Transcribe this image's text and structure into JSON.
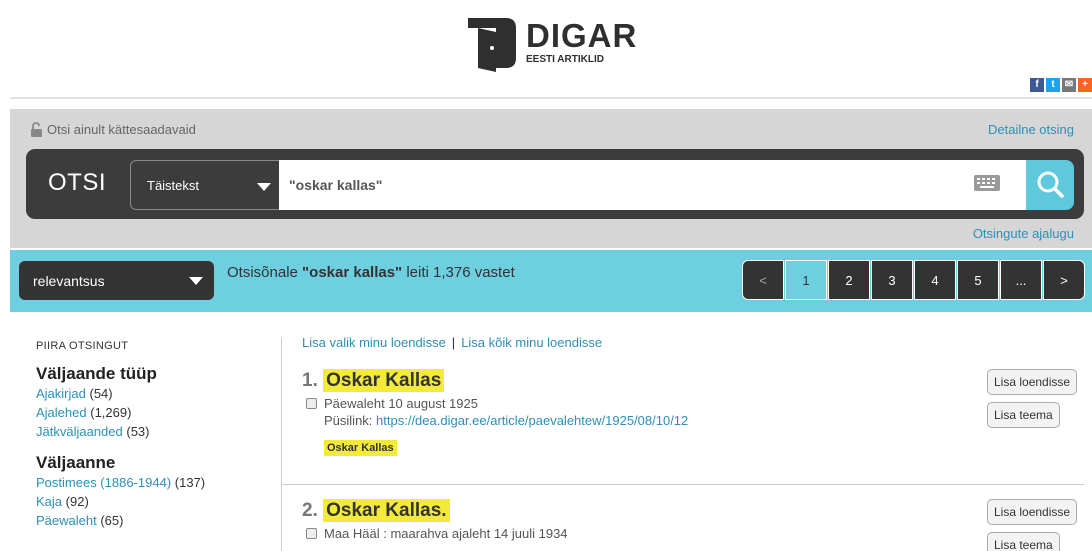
{
  "header": {
    "logo_title": "DIGAR",
    "logo_subtitle": "EESTI ARTIKLID",
    "social": [
      "f",
      "t",
      "✉",
      "+"
    ]
  },
  "search": {
    "only_available": "Otsi ainult kättesaadavaid",
    "detailed_link": "Detailne otsing",
    "otsi_label": "OTSI",
    "type_value": "Täistekst",
    "query": "\"oskar kallas\"",
    "history_link": "Otsingute ajalugu"
  },
  "results_bar": {
    "sort_value": "relevantsus",
    "count_prefix": "Otsisõnale ",
    "count_query": "\"oskar kallas\"",
    "count_suffix": " leiti 1,376 vastet",
    "pages": [
      "<",
      "1",
      "2",
      "3",
      "4",
      "5",
      "...",
      ">"
    ]
  },
  "sidebar": {
    "title": "PIIRA OTSINGUT",
    "groups": [
      {
        "heading": "Väljaande tüüp",
        "items": [
          {
            "label": "Ajakirjad",
            "count": "(54)"
          },
          {
            "label": "Ajalehed",
            "count": "(1,269)"
          },
          {
            "label": "Jätkväljaanded",
            "count": "(53)"
          }
        ]
      },
      {
        "heading": "Väljaanne",
        "items": [
          {
            "label": "Postimees (1886-1944)",
            "count": "(137)"
          },
          {
            "label": "Kaja",
            "count": "(92)"
          },
          {
            "label": "Päewaleht",
            "count": "(65)"
          }
        ]
      }
    ]
  },
  "main": {
    "add_selected": "Lisa valik minu loendisse",
    "separator": "|",
    "add_all": "Lisa kõik minu loendisse",
    "results": [
      {
        "num": "1.",
        "title": "Oskar Kallas",
        "source": "Päewaleht 10 august 1925",
        "link_label": "Püsilink: ",
        "link": "https://dea.digar.ee/article/paevalehtew/1925/08/10/12",
        "tag": "Oskar Kallas",
        "btn_list": "Lisa loendisse",
        "btn_topic": "Lisa teema"
      },
      {
        "num": "2.",
        "title": "Oskar Kallas.",
        "source": "Maa Hääl : maarahva ajaleht 14 juuli 1934",
        "btn_list": "Lisa loendisse",
        "btn_topic": "Lisa teema"
      }
    ]
  }
}
